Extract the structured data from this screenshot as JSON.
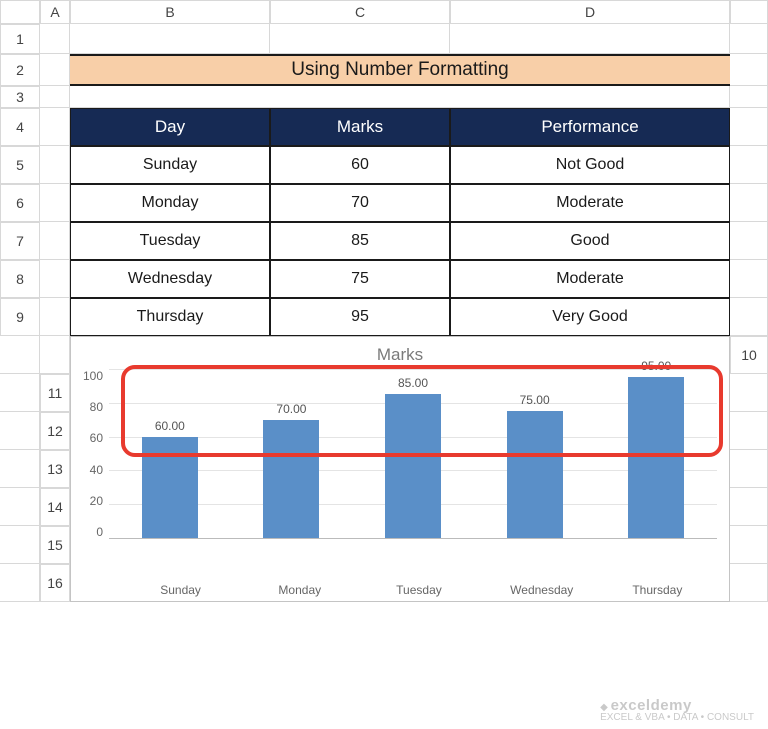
{
  "columns": [
    "A",
    "B",
    "C",
    "D"
  ],
  "rows": [
    "1",
    "2",
    "3",
    "4",
    "5",
    "6",
    "7",
    "8",
    "9",
    "10",
    "11",
    "12",
    "13",
    "14",
    "15",
    "16"
  ],
  "title": "Using Number Formatting",
  "table": {
    "headers": [
      "Day",
      "Marks",
      "Performance"
    ],
    "data": [
      {
        "day": "Sunday",
        "marks": "60",
        "perf": "Not Good"
      },
      {
        "day": "Monday",
        "marks": "70",
        "perf": "Moderate"
      },
      {
        "day": "Tuesday",
        "marks": "85",
        "perf": "Good"
      },
      {
        "day": "Wednesday",
        "marks": "75",
        "perf": "Moderate"
      },
      {
        "day": "Thursday",
        "marks": "95",
        "perf": "Very Good"
      }
    ]
  },
  "chart_data": {
    "type": "bar",
    "title": "Marks",
    "categories": [
      "Sunday",
      "Monday",
      "Tuesday",
      "Wednesday",
      "Thursday"
    ],
    "values": [
      60,
      70,
      85,
      75,
      95
    ],
    "data_labels": [
      "60.00",
      "70.00",
      "85.00",
      "75.00",
      "95.00"
    ],
    "xlabel": "",
    "ylabel": "",
    "ylim": [
      0,
      100
    ],
    "yticks": [
      0,
      20,
      40,
      60,
      80,
      100
    ]
  },
  "watermark": {
    "brand": "exceldemy",
    "tagline": "EXCEL & VBA • DATA • CONSULT"
  }
}
